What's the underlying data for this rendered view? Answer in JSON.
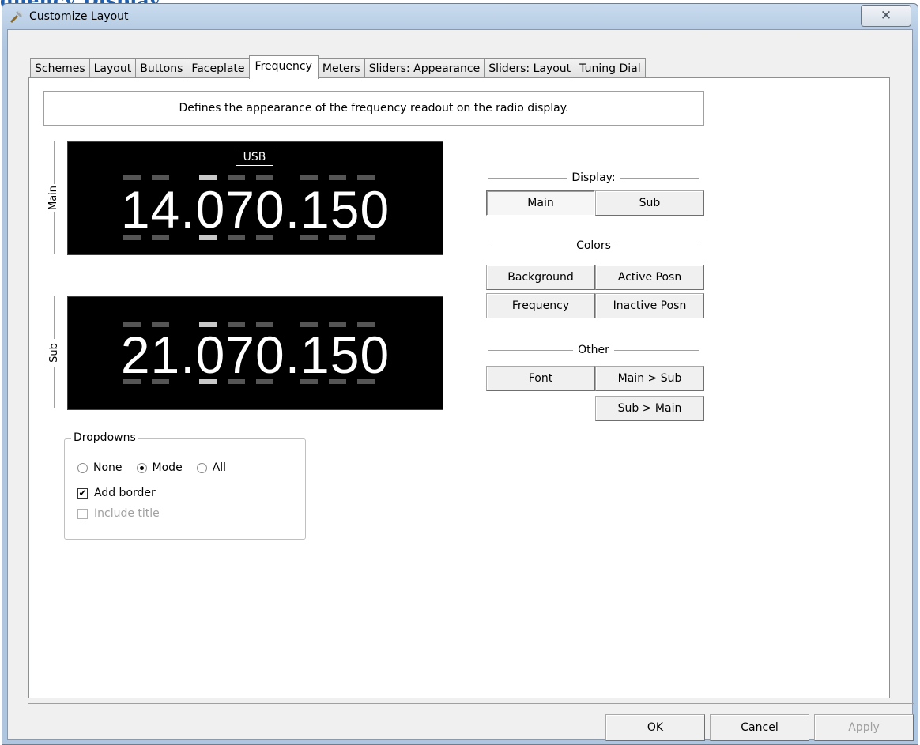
{
  "background": {
    "partial_heading": "quency Display"
  },
  "window": {
    "title": "Customize Layout",
    "close_glyph": "✕"
  },
  "tabs": [
    {
      "label": "Schemes",
      "active": false
    },
    {
      "label": "Layout",
      "active": false
    },
    {
      "label": "Buttons",
      "active": false
    },
    {
      "label": "Faceplate",
      "active": false
    },
    {
      "label": "Frequency",
      "active": true
    },
    {
      "label": "Meters",
      "active": false
    },
    {
      "label": "Sliders: Appearance",
      "active": false
    },
    {
      "label": "Sliders: Layout",
      "active": false
    },
    {
      "label": "Tuning Dial",
      "active": false
    }
  ],
  "description": "Defines the appearance of the frequency readout on the radio display.",
  "preview": {
    "main": {
      "label": "Main",
      "mode": "USB",
      "frequency": "14.070.150"
    },
    "sub": {
      "label": "Sub",
      "frequency": "21.070.150"
    }
  },
  "sections": {
    "display": {
      "title": "Display:",
      "main_btn": "Main",
      "sub_btn": "Sub"
    },
    "colors": {
      "title": "Colors",
      "background_btn": "Background",
      "active_posn_btn": "Active Posn",
      "frequency_btn": "Frequency",
      "inactive_posn_btn": "Inactive Posn"
    },
    "other": {
      "title": "Other",
      "font_btn": "Font",
      "main_to_sub_btn": "Main > Sub",
      "sub_to_main_btn": "Sub > Main"
    }
  },
  "dropdowns": {
    "title": "Dropdowns",
    "options": {
      "none": "None",
      "mode": "Mode",
      "all": "All"
    },
    "selected": "Mode",
    "add_border": {
      "label": "Add border",
      "checked": true
    },
    "include_title": {
      "label": "Include title",
      "checked": false,
      "disabled": true
    }
  },
  "footer": {
    "ok": "OK",
    "cancel": "Cancel",
    "apply": "Apply"
  }
}
